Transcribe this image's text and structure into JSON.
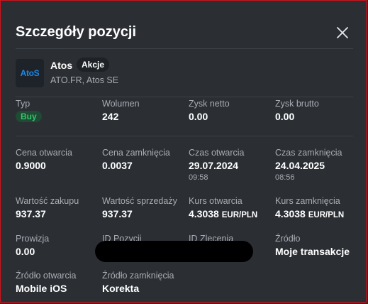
{
  "modal": {
    "title": "Szczegóły pozycji",
    "close_icon": "close-icon"
  },
  "instrument": {
    "logo_text": "AtoS",
    "name": "Atos",
    "badge": "Akcje",
    "subtitle": "ATO.FR, Atos SE"
  },
  "fields": {
    "typ": {
      "label": "Typ",
      "value": "Buy"
    },
    "wolumen": {
      "label": "Wolumen",
      "value": "242"
    },
    "zysk_netto": {
      "label": "Zysk netto",
      "value": "0.00"
    },
    "zysk_brutto": {
      "label": "Zysk brutto",
      "value": "0.00"
    },
    "cena_otwarcia": {
      "label": "Cena otwarcia",
      "value": "0.9000"
    },
    "cena_zamkniecia": {
      "label": "Cena zamknięcia",
      "value": "0.0037"
    },
    "czas_otwarcia": {
      "label": "Czas otwarcia",
      "date": "29.07.2024",
      "time": "09:58"
    },
    "czas_zamkniecia": {
      "label": "Czas zamknięcia",
      "date": "24.04.2025",
      "time": "08:56"
    },
    "wartosc_zakupu": {
      "label": "Wartość zakupu",
      "value": "937.37"
    },
    "wartosc_sprzedazy": {
      "label": "Wartość sprzedaży",
      "value": "937.37"
    },
    "kurs_otwarcia": {
      "label": "Kurs otwarcia",
      "value": "4.3038",
      "unit": "EUR/PLN"
    },
    "kurs_zamkniecia": {
      "label": "Kurs zamknięcia",
      "value": "4.3038",
      "unit": "EUR/PLN"
    },
    "prowizja": {
      "label": "Prowizja",
      "value": "0.00"
    },
    "id_pozycji": {
      "label": "ID Pozycji"
    },
    "id_zlecenia": {
      "label": "ID Zlecenia"
    },
    "zrodlo": {
      "label": "Źródło",
      "value": "Moje transakcje"
    },
    "zrodlo_otwarcia": {
      "label": "Źródło otwarcia",
      "value": "Mobile iOS"
    },
    "zrodlo_zamkniecia": {
      "label": "Źródło zamknięcia",
      "value": "Korekta"
    }
  },
  "colors": {
    "buy_text": "#37c46e",
    "buy_bg": "#1f4a33",
    "accent_border": "#d0121b",
    "logo_blue": "#1f88e5"
  }
}
